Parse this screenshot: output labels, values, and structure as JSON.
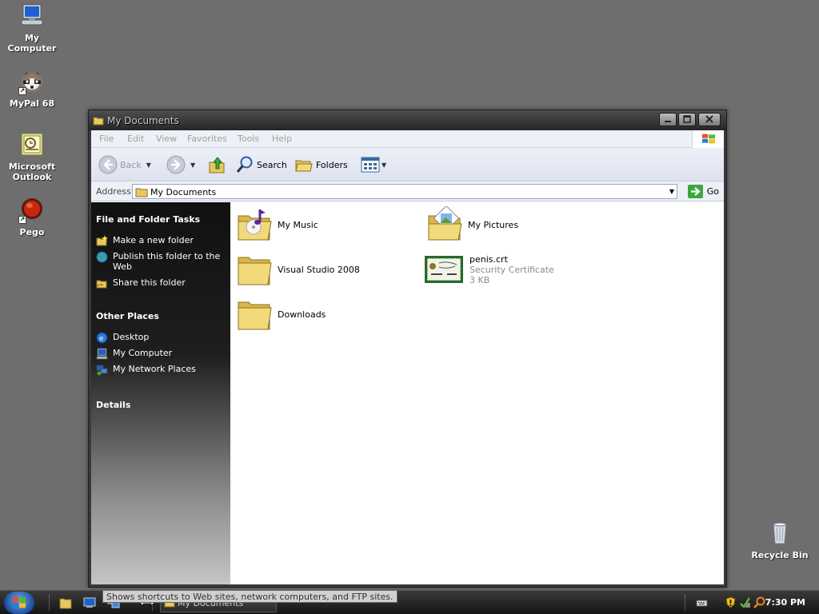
{
  "desktop": {
    "icons": [
      {
        "label": "My Computer",
        "icon": "my-computer-icon"
      },
      {
        "label": "MyPal 68",
        "icon": "mypal-raccoon-icon"
      },
      {
        "label": "Microsoft Outlook",
        "icon": "outlook-icon"
      },
      {
        "label": "Pego",
        "icon": "pego-red-orb-icon"
      },
      {
        "label": "Recycle Bin",
        "icon": "recycle-bin-icon"
      }
    ]
  },
  "window": {
    "title": "My Documents",
    "menu": [
      "File",
      "Edit",
      "View",
      "Favorites",
      "Tools",
      "Help"
    ],
    "toolbar": {
      "back_label": "Back",
      "search_label": "Search",
      "folders_label": "Folders"
    },
    "address": {
      "label": "Address",
      "value": "My Documents",
      "go_label": "Go"
    },
    "taskpane": {
      "file_tasks": {
        "header": "File and Folder Tasks",
        "items": [
          "Make a new folder",
          "Publish this folder to the Web",
          "Share this folder"
        ]
      },
      "other_places": {
        "header": "Other Places",
        "items": [
          "Desktop",
          "My Computer",
          "My Network Places"
        ]
      },
      "details": {
        "header": "Details"
      }
    },
    "files": [
      {
        "name": "My Music",
        "icon": "music-folder-icon"
      },
      {
        "name": "My Pictures",
        "icon": "pictures-folder-icon"
      },
      {
        "name": "Visual Studio 2008",
        "icon": "folder-icon"
      },
      {
        "name": "penis.crt",
        "type": "Security Certificate",
        "size": "3 KB",
        "icon": "certificate-icon"
      },
      {
        "name": "Downloads",
        "icon": "folder-icon"
      }
    ]
  },
  "taskbar": {
    "task_label": "My Documents",
    "tooltip": "Shows shortcuts to Web sites, network computers, and FTP sites.",
    "clock": "7:30 PM"
  },
  "colors": {
    "desktop": "#6e6e6e",
    "window_frame": "#3a3a3a",
    "taskpane_top": "#111111",
    "menu_bar": "#eef0f8"
  }
}
